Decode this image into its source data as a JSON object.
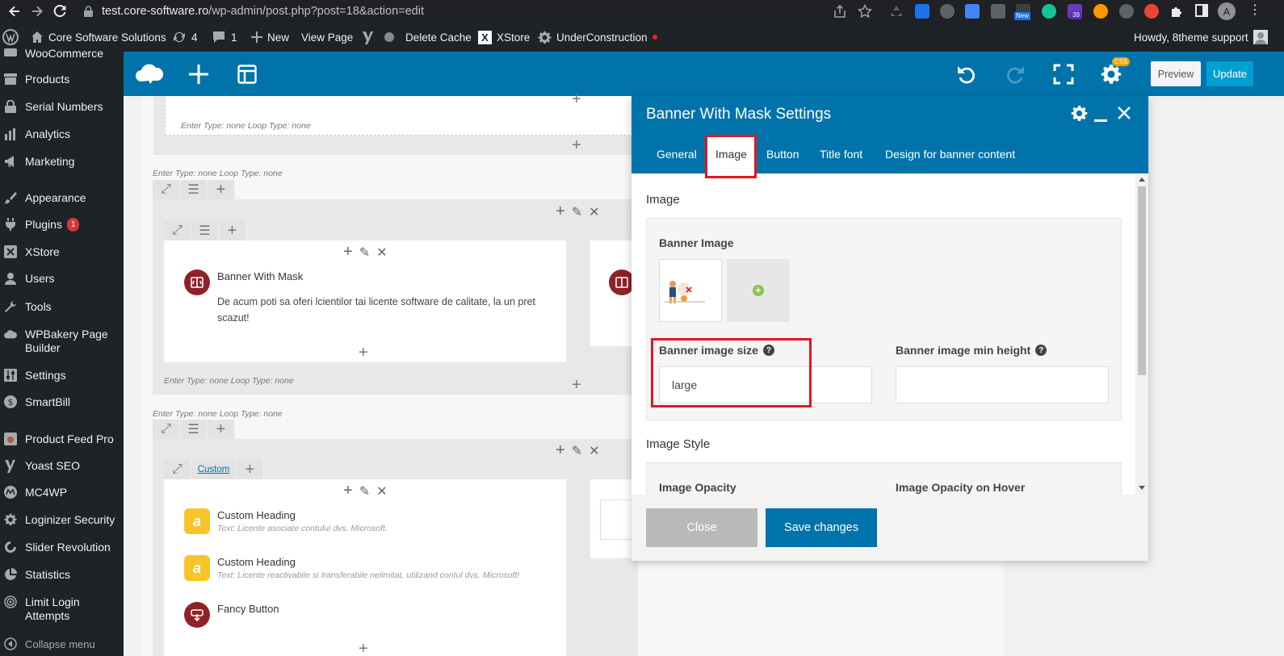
{
  "browser": {
    "url_host": "test.core-software.ro",
    "url_path": "/wp-admin/post.php?post=18&action=edit",
    "ext_badge_39": "39",
    "ext_badge_new": "New",
    "profile_initial": "A"
  },
  "adminbar": {
    "site_name": "Core Software Solutions",
    "updates_count": "4",
    "comments_count": "1",
    "new_label": "New",
    "view_page": "View Page",
    "delete_cache": "Delete Cache",
    "xstore": "XStore",
    "under_construction": "UnderConstruction",
    "howdy": "Howdy, 8theme support"
  },
  "sidebar": {
    "items": [
      {
        "label": "WooCommerce"
      },
      {
        "label": "Products"
      },
      {
        "label": "Serial Numbers"
      },
      {
        "label": "Analytics"
      },
      {
        "label": "Marketing"
      },
      {
        "label": "Appearance"
      },
      {
        "label": "Plugins",
        "badge": "1"
      },
      {
        "label": "XStore"
      },
      {
        "label": "Users"
      },
      {
        "label": "Tools"
      },
      {
        "label": "WPBakery Page Builder"
      },
      {
        "label": "Settings"
      },
      {
        "label": "SmartBill"
      },
      {
        "label": "Product Feed Pro"
      },
      {
        "label": "Yoast SEO"
      },
      {
        "label": "MC4WP"
      },
      {
        "label": "Loginizer Security"
      },
      {
        "label": "Slider Revolution"
      },
      {
        "label": "Statistics"
      },
      {
        "label": "Limit Login Attempts"
      },
      {
        "label": "Collapse menu"
      }
    ]
  },
  "toolbar": {
    "css_badge": "CSS",
    "preview_label": "Preview",
    "update_label": "Update"
  },
  "canvas": {
    "meta_text": "Enter Type: none  Loop Type: none",
    "banner_title": "Banner With Mask",
    "banner_desc": "De acum poti sa oferi lcientilor tai licente software de calitate, la un pret scazut!",
    "custom_tab": "Custom",
    "heading1_title": "Custom Heading",
    "heading1_desc": "Text: Licente asociate contului dvs. Microsoft.",
    "heading2_title": "Custom Heading",
    "heading2_desc": "Text: Licente reactivabile si transferabile nelimitat, utilizand contul dvs. Microsoft!",
    "fancy_button": "Fancy Button",
    "heading_icon_letter": "a"
  },
  "modal": {
    "title": "Banner With Mask Settings",
    "tabs": [
      "General",
      "Image",
      "Button",
      "Title font",
      "Design for banner content"
    ],
    "active_tab": "Image",
    "section_image": "Image",
    "banner_image_label": "Banner Image",
    "banner_image_size_label": "Banner image size",
    "banner_image_size_value": "large",
    "banner_image_min_height_label": "Banner image min height",
    "banner_image_min_height_value": "",
    "section_image_style": "Image Style",
    "image_opacity_label": "Image Opacity",
    "image_opacity_hover_label": "Image Opacity on Hover",
    "help_glyph": "?",
    "close_label": "Close",
    "save_label": "Save changes"
  },
  "colors": {
    "wp_dark": "#1d2327",
    "vc_blue": "#0073aa",
    "highlight_red": "#e3161f",
    "update_blue": "#00a0d2",
    "save_blue": "#0073aa",
    "close_grey": "#b9b9b9"
  }
}
